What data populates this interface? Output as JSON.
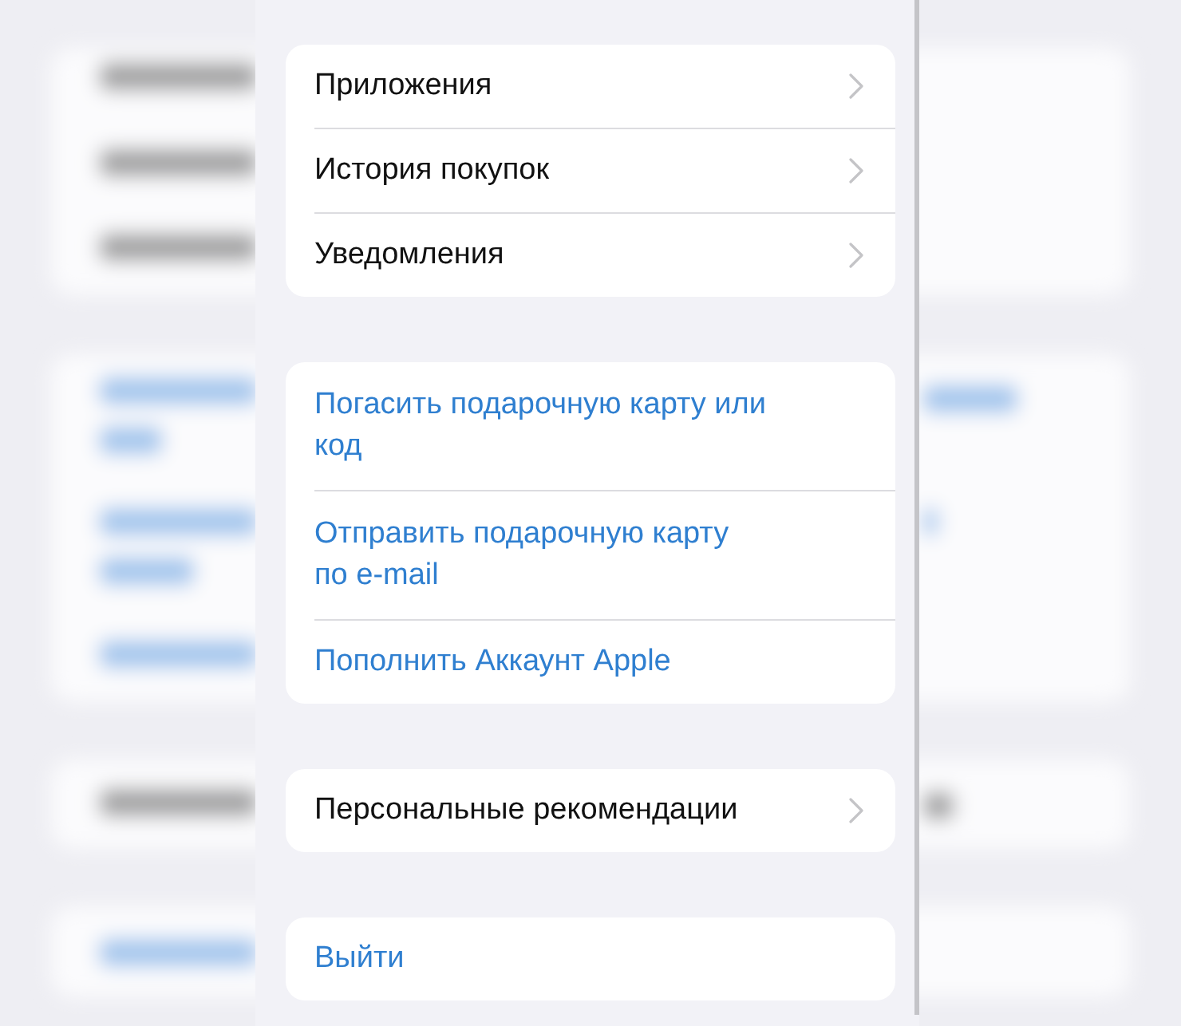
{
  "groups": [
    {
      "items": [
        {
          "label": "Приложения",
          "kind": "nav"
        },
        {
          "label": "История покупок",
          "kind": "nav"
        },
        {
          "label": "Уведомления",
          "kind": "nav"
        }
      ]
    },
    {
      "items": [
        {
          "label": "Погасить подарочную карту или\nкод",
          "kind": "action"
        },
        {
          "label": "Отправить подарочную карту\nпо e-mail",
          "kind": "action"
        },
        {
          "label": "Пополнить Аккаунт Apple",
          "kind": "action"
        }
      ]
    },
    {
      "items": [
        {
          "label": "Персональные рекомендации",
          "kind": "nav"
        }
      ]
    },
    {
      "items": [
        {
          "label": "Выйти",
          "kind": "action"
        }
      ]
    }
  ]
}
